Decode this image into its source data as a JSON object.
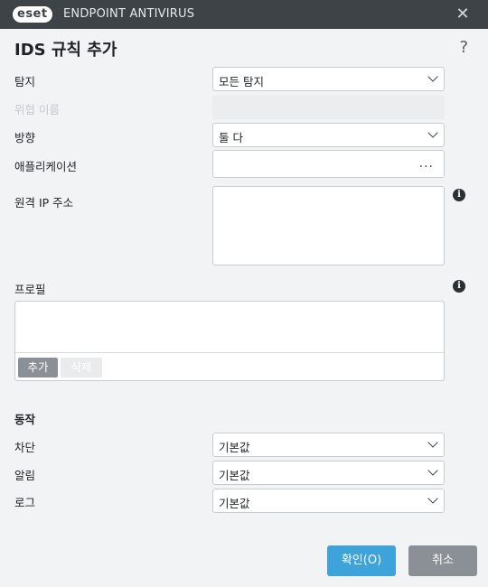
{
  "titlebar": {
    "logo": "eset",
    "app_name": "ENDPOINT ANTIVIRUS",
    "close_icon": "close-icon"
  },
  "dialog": {
    "title": "IDS 규칙 추가",
    "help": "?"
  },
  "form": {
    "detection": {
      "label": "탐지",
      "value": "모든 탐지"
    },
    "threat_name": {
      "label": "위협 이름",
      "value": ""
    },
    "direction": {
      "label": "방향",
      "value": "둘 다"
    },
    "application": {
      "label": "애플리케이션",
      "value": "",
      "browse": "..."
    },
    "remote_ip": {
      "label": "원격 IP 주소",
      "value": ""
    },
    "profile": {
      "label": "프로필",
      "add": "추가",
      "delete": "삭제"
    }
  },
  "actions": {
    "heading": "동작",
    "block": {
      "label": "차단",
      "value": "기본값"
    },
    "notify": {
      "label": "알림",
      "value": "기본값"
    },
    "log": {
      "label": "로그",
      "value": "기본값"
    }
  },
  "footer": {
    "ok": "확인(O)",
    "cancel": "취소"
  },
  "colors": {
    "titlebar": "#3d4347",
    "primary_button": "#3da3d9",
    "secondary_button": "#8a9095"
  }
}
